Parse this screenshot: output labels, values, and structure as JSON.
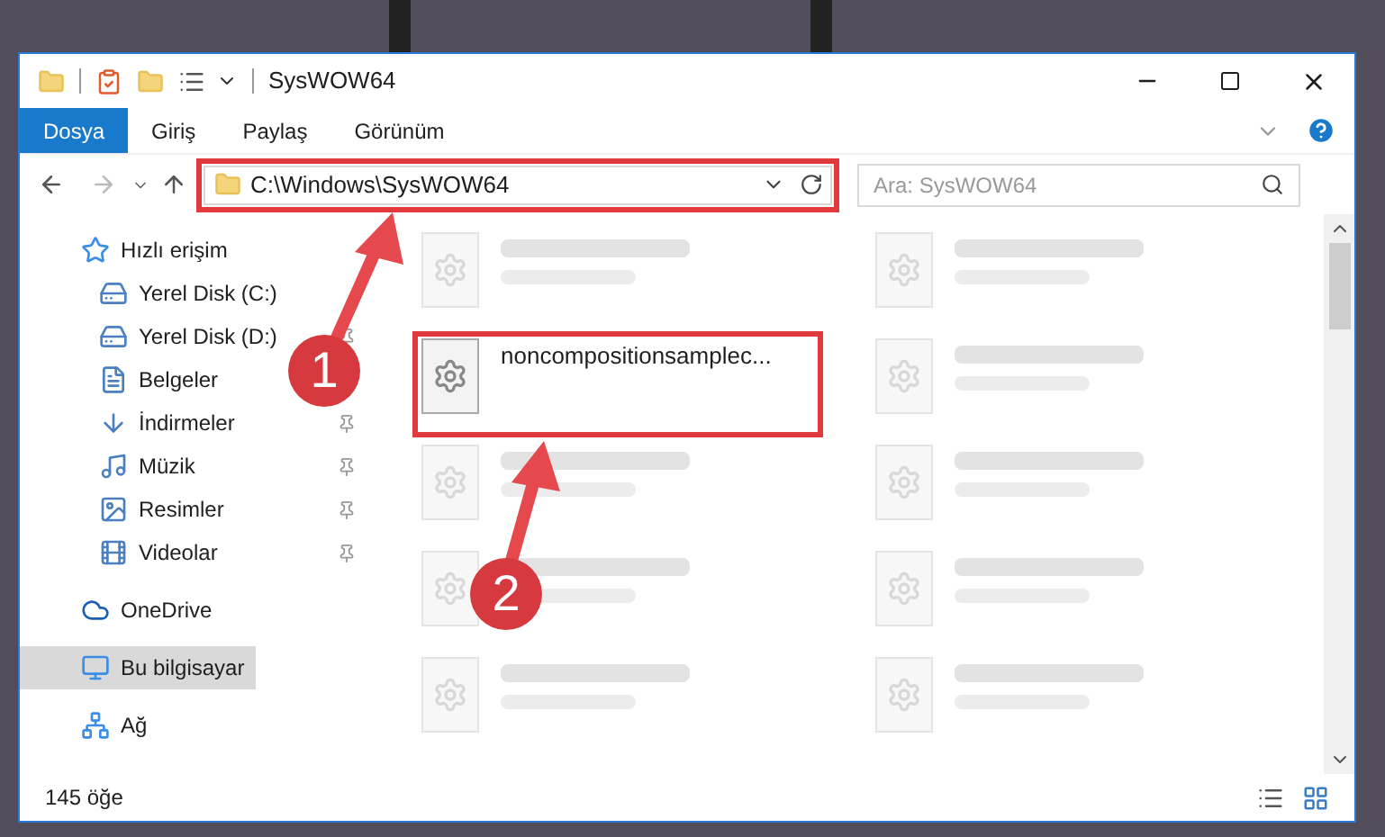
{
  "window": {
    "title": "SysWOW64"
  },
  "ribbon_tabs": [
    {
      "label": "Dosya",
      "selected": true
    },
    {
      "label": "Giriş",
      "selected": false
    },
    {
      "label": "Paylaş",
      "selected": false
    },
    {
      "label": "Görünüm",
      "selected": false
    }
  ],
  "address_bar": {
    "path": "C:\\Windows\\SysWOW64",
    "highlighted": true
  },
  "search": {
    "placeholder": "Ara: SysWOW64"
  },
  "sidebar": {
    "items": [
      {
        "label": "Hızlı erişim",
        "selected": false,
        "children": [
          {
            "label": "Yerel Disk (C:)",
            "pinned": false
          },
          {
            "label": "Yerel Disk (D:)",
            "pinned": true
          },
          {
            "label": "Belgeler"
          },
          {
            "label": "İndirmeler",
            "pinned": true
          },
          {
            "label": "Müzik",
            "pinned": true
          },
          {
            "label": "Resimler",
            "pinned": true
          },
          {
            "label": "Videolar",
            "pinned": true
          }
        ]
      },
      {
        "label": "OneDrive",
        "selected": false
      },
      {
        "label": "Bu bilgisayar",
        "selected": true
      },
      {
        "label": "Ağ",
        "selected": false
      }
    ]
  },
  "files": [
    {
      "kind": "blurred"
    },
    {
      "kind": "blurred"
    },
    {
      "kind": "file",
      "name": "noncompositionsamplec...",
      "highlighted": true
    },
    {
      "kind": "blurred"
    },
    {
      "kind": "blurred"
    },
    {
      "kind": "blurred"
    },
    {
      "kind": "blurred"
    },
    {
      "kind": "blurred"
    },
    {
      "kind": "blurred"
    },
    {
      "kind": "blurred"
    }
  ],
  "status_bar": {
    "count": "145 öğe"
  },
  "annotations": [
    {
      "number": "1"
    },
    {
      "number": "2"
    }
  ]
}
